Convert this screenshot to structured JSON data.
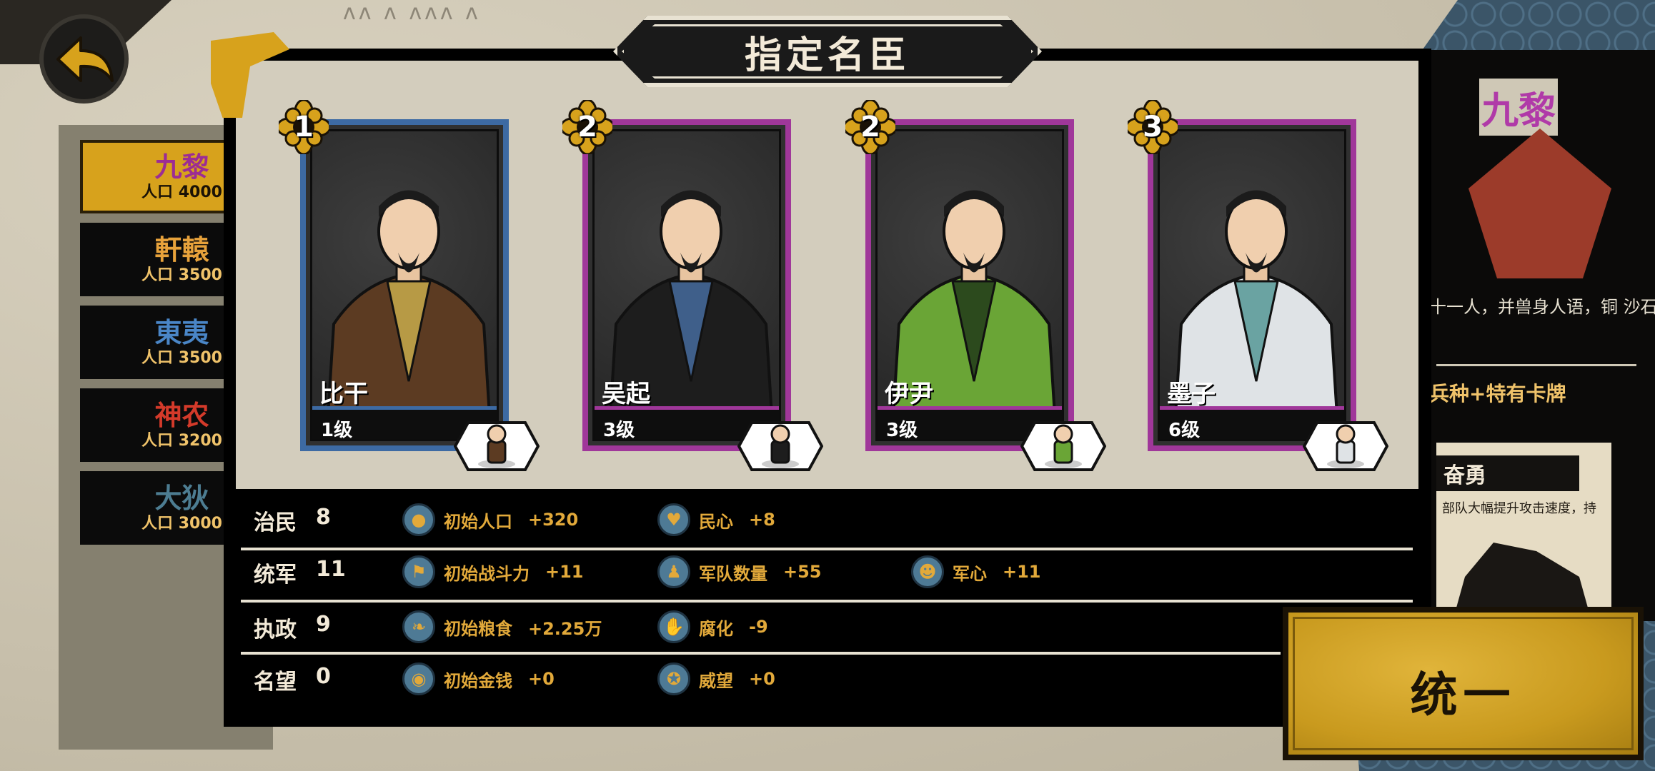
{
  "dialog": {
    "title": "指定名臣"
  },
  "tribes": [
    {
      "name": "九黎",
      "population": "人口 4000",
      "color": "#9c2c94",
      "active": true
    },
    {
      "name": "軒轅",
      "population": "人口 3500",
      "color": "#e7a23b",
      "active": false
    },
    {
      "name": "東夷",
      "population": "人口 3500",
      "color": "#4a86c7",
      "active": false
    },
    {
      "name": "神农",
      "population": "人口 3200",
      "color": "#d43a2a",
      "active": false
    },
    {
      "name": "大狄",
      "population": "人口 3000",
      "color": "#4d7d92",
      "active": false
    }
  ],
  "heroes": [
    {
      "name": "比干",
      "level": "1级",
      "stars": "1",
      "frame": "blue",
      "robe": "#5c3b22",
      "accent": "#b79a45"
    },
    {
      "name": "吴起",
      "level": "3级",
      "stars": "2",
      "frame": "purple",
      "robe": "#1d1d1d",
      "accent": "#3f5f8a"
    },
    {
      "name": "伊尹",
      "level": "3级",
      "stars": "2",
      "frame": "purple",
      "robe": "#6aa536",
      "accent": "#2c4a1d"
    },
    {
      "name": "墨子",
      "level": "6级",
      "stars": "3",
      "frame": "purple",
      "robe": "#dfe3e6",
      "accent": "#6aa3a2"
    }
  ],
  "stats": [
    {
      "label": "治民",
      "value": "8",
      "effects": [
        {
          "icon": "population-icon",
          "name": "初始人口",
          "value": "+320"
        },
        {
          "icon": "loyalty-heart-icon",
          "name": "民心",
          "value": "+8"
        }
      ]
    },
    {
      "label": "统军",
      "value": "11",
      "effects": [
        {
          "icon": "combat-power-icon",
          "name": "初始战斗力",
          "value": "+11"
        },
        {
          "icon": "army-count-icon",
          "name": "军队数量",
          "value": "+55"
        },
        {
          "icon": "army-morale-icon",
          "name": "军心",
          "value": "+11"
        }
      ]
    },
    {
      "label": "执政",
      "value": "9",
      "effects": [
        {
          "icon": "grain-icon",
          "name": "初始粮食",
          "value": "+2.25万"
        },
        {
          "icon": "corruption-hand-icon",
          "name": "腐化",
          "value": "-9"
        }
      ]
    },
    {
      "label": "名望",
      "value": "0",
      "effects": [
        {
          "icon": "coin-icon",
          "name": "初始金钱",
          "value": "+0"
        },
        {
          "icon": "prestige-icon",
          "name": "威望",
          "value": "+0"
        }
      ]
    }
  ],
  "side_panel": {
    "tribe_name": "九黎",
    "description": "十一人，并兽身人语，铜  沙石子，勇猛无比，有雄",
    "unit_label": "兵种+特有卡牌",
    "card_title": "奋勇",
    "card_text": "部队大幅提升攻击速度，持"
  },
  "unify_button": {
    "label": "统一"
  },
  "colors": {
    "gold": "#d7a21c",
    "effect_text": "#e2a93a",
    "frame_blue": "#3d6aa3",
    "frame_purple": "#a0379a"
  }
}
